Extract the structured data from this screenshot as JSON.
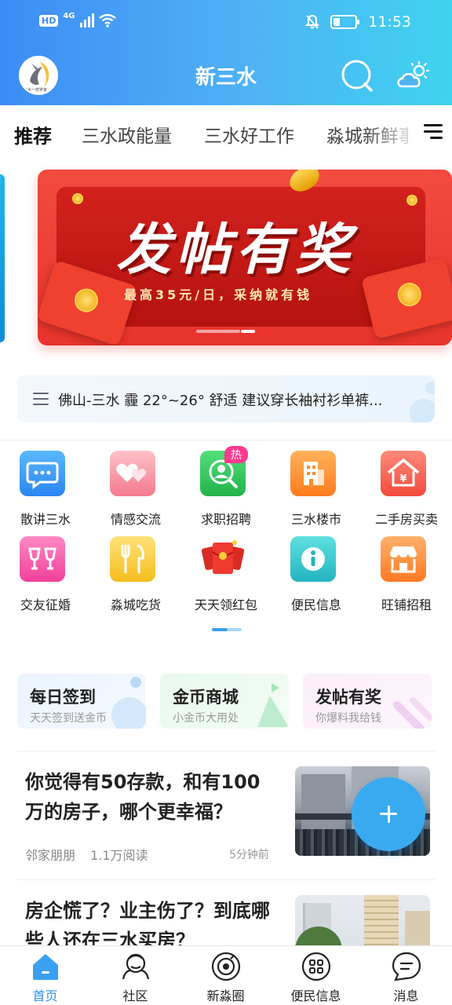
{
  "status_bar": {
    "hd": "HD",
    "network": "4G",
    "time": "11:53"
  },
  "header": {
    "avatar_text": "三水一样罗家",
    "title": "新三水"
  },
  "tabs": [
    {
      "label": "推荐",
      "active": true
    },
    {
      "label": "三水政能量",
      "active": false
    },
    {
      "label": "三水好工作",
      "active": false
    },
    {
      "label": "淼城新鲜事",
      "active": false
    }
  ],
  "banner": {
    "title": "发帖有奖",
    "subtitle": "最高35元/日，采纳就有钱",
    "current_slide": 2,
    "slide_count": 2
  },
  "weather_notice": {
    "text": "佛山-三水 霾 22°~26° 舒适 建议穿长袖衬衫单裤..."
  },
  "shortcuts": [
    {
      "label": "散讲三水",
      "icon": "chat-bubble-icon",
      "color": "#3b9ff5"
    },
    {
      "label": "情感交流",
      "icon": "hearts-icon",
      "color": "#f48aa0"
    },
    {
      "label": "求职招聘",
      "icon": "job-search-icon",
      "color": "#37c85a",
      "badge": "热"
    },
    {
      "label": "三水楼市",
      "icon": "building-icon",
      "color": "#ff8a2a"
    },
    {
      "label": "二手房买卖",
      "icon": "house-icon",
      "color": "#ff5a48"
    },
    {
      "label": "交友征婚",
      "icon": "wine-glasses-icon",
      "color": "#f24f9a"
    },
    {
      "label": "淼城吃货",
      "icon": "fork-knife-icon",
      "color": "#f6c52a"
    },
    {
      "label": "天天领红包",
      "icon": "red-envelope-icon",
      "color": "#e8332c"
    },
    {
      "label": "便民信息",
      "icon": "info-icon",
      "color": "#2fc3c8"
    },
    {
      "label": "旺铺招租",
      "icon": "shop-icon",
      "color": "#ff8030"
    }
  ],
  "promo_cards": [
    {
      "title": "每日签到",
      "subtitle": "天天签到送金币"
    },
    {
      "title": "金币商城",
      "subtitle": "小金币大用处"
    },
    {
      "title": "发帖有奖",
      "subtitle": "你爆料我给钱"
    }
  ],
  "articles": [
    {
      "title": "你觉得有50存款，和有100万的房子，哪个更幸福？",
      "author": "邻家朋朋",
      "views": "1.1万阅读",
      "time": "5分钟前"
    },
    {
      "title": "房企慌了？业主伤了？到底哪些人还在三水买房？",
      "author": "",
      "views": "",
      "time": ""
    }
  ],
  "bottom_nav": [
    {
      "label": "首页",
      "icon": "home-icon",
      "active": true
    },
    {
      "label": "社区",
      "icon": "community-icon",
      "active": false
    },
    {
      "label": "新淼圈",
      "icon": "circle-icon",
      "active": false
    },
    {
      "label": "便民信息",
      "icon": "grid-apps-icon",
      "active": false
    },
    {
      "label": "消息",
      "icon": "message-icon",
      "active": false
    }
  ],
  "colors": {
    "header_gradient_start": "#3d8cf5",
    "header_gradient_end": "#3ed3f0",
    "accent": "#2d8ff0",
    "banner_red": "#e8332c"
  }
}
